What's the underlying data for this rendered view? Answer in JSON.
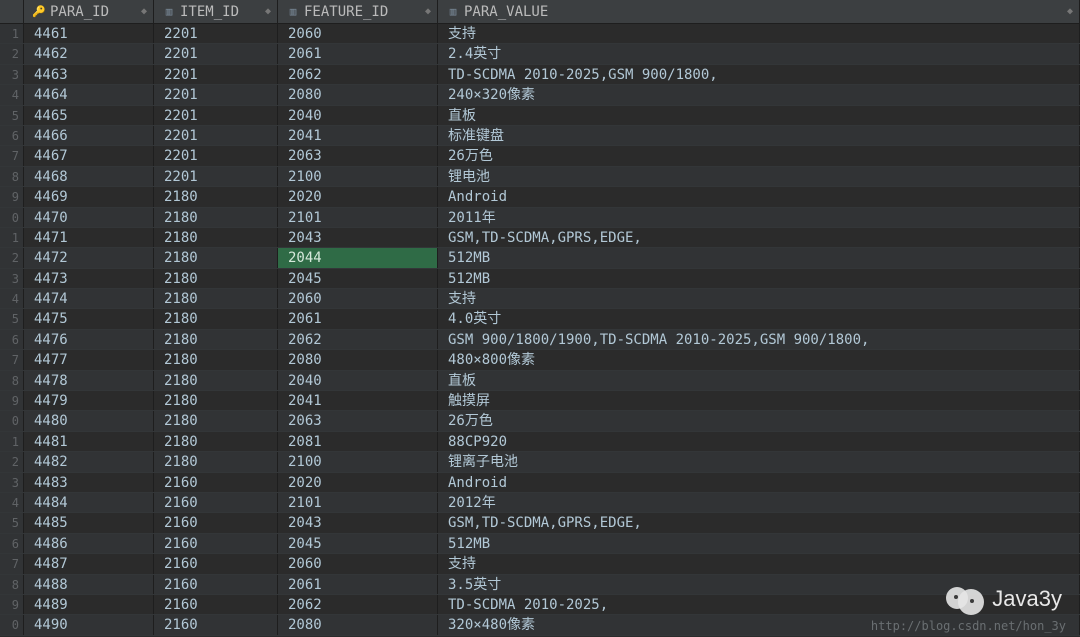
{
  "columns": [
    {
      "key": "para_id",
      "label": "PARA_ID",
      "icon": "key"
    },
    {
      "key": "item_id",
      "label": "ITEM_ID",
      "icon": "col"
    },
    {
      "key": "feature_id",
      "label": "FEATURE_ID",
      "icon": "col"
    },
    {
      "key": "para_value",
      "label": "PARA_VALUE",
      "icon": "col"
    }
  ],
  "highlight": {
    "row_index": 11,
    "col": "feature_id"
  },
  "rows": [
    {
      "n": "1",
      "para_id": "4461",
      "item_id": "2201",
      "feature_id": "2060",
      "para_value": "支持"
    },
    {
      "n": "2",
      "para_id": "4462",
      "item_id": "2201",
      "feature_id": "2061",
      "para_value": "2.4英寸"
    },
    {
      "n": "3",
      "para_id": "4463",
      "item_id": "2201",
      "feature_id": "2062",
      "para_value": "TD-SCDMA 2010-2025,GSM 900/1800,"
    },
    {
      "n": "4",
      "para_id": "4464",
      "item_id": "2201",
      "feature_id": "2080",
      "para_value": "240×320像素"
    },
    {
      "n": "5",
      "para_id": "4465",
      "item_id": "2201",
      "feature_id": "2040",
      "para_value": "直板"
    },
    {
      "n": "6",
      "para_id": "4466",
      "item_id": "2201",
      "feature_id": "2041",
      "para_value": "标准键盘"
    },
    {
      "n": "7",
      "para_id": "4467",
      "item_id": "2201",
      "feature_id": "2063",
      "para_value": "26万色"
    },
    {
      "n": "8",
      "para_id": "4468",
      "item_id": "2201",
      "feature_id": "2100",
      "para_value": "锂电池"
    },
    {
      "n": "9",
      "para_id": "4469",
      "item_id": "2180",
      "feature_id": "2020",
      "para_value": "Android"
    },
    {
      "n": "0",
      "para_id": "4470",
      "item_id": "2180",
      "feature_id": "2101",
      "para_value": "2011年"
    },
    {
      "n": "1",
      "para_id": "4471",
      "item_id": "2180",
      "feature_id": "2043",
      "para_value": "GSM,TD-SCDMA,GPRS,EDGE,"
    },
    {
      "n": "2",
      "para_id": "4472",
      "item_id": "2180",
      "feature_id": "2044",
      "para_value": "512MB"
    },
    {
      "n": "3",
      "para_id": "4473",
      "item_id": "2180",
      "feature_id": "2045",
      "para_value": "512MB"
    },
    {
      "n": "4",
      "para_id": "4474",
      "item_id": "2180",
      "feature_id": "2060",
      "para_value": "支持"
    },
    {
      "n": "5",
      "para_id": "4475",
      "item_id": "2180",
      "feature_id": "2061",
      "para_value": "4.0英寸"
    },
    {
      "n": "6",
      "para_id": "4476",
      "item_id": "2180",
      "feature_id": "2062",
      "para_value": "GSM 900/1800/1900,TD-SCDMA 2010-2025,GSM 900/1800,"
    },
    {
      "n": "7",
      "para_id": "4477",
      "item_id": "2180",
      "feature_id": "2080",
      "para_value": "480×800像素"
    },
    {
      "n": "8",
      "para_id": "4478",
      "item_id": "2180",
      "feature_id": "2040",
      "para_value": "直板"
    },
    {
      "n": "9",
      "para_id": "4479",
      "item_id": "2180",
      "feature_id": "2041",
      "para_value": "触摸屏"
    },
    {
      "n": "0",
      "para_id": "4480",
      "item_id": "2180",
      "feature_id": "2063",
      "para_value": "26万色"
    },
    {
      "n": "1",
      "para_id": "4481",
      "item_id": "2180",
      "feature_id": "2081",
      "para_value": "88CP920"
    },
    {
      "n": "2",
      "para_id": "4482",
      "item_id": "2180",
      "feature_id": "2100",
      "para_value": "锂离子电池"
    },
    {
      "n": "3",
      "para_id": "4483",
      "item_id": "2160",
      "feature_id": "2020",
      "para_value": "Android"
    },
    {
      "n": "4",
      "para_id": "4484",
      "item_id": "2160",
      "feature_id": "2101",
      "para_value": "2012年"
    },
    {
      "n": "5",
      "para_id": "4485",
      "item_id": "2160",
      "feature_id": "2043",
      "para_value": "GSM,TD-SCDMA,GPRS,EDGE,"
    },
    {
      "n": "6",
      "para_id": "4486",
      "item_id": "2160",
      "feature_id": "2045",
      "para_value": "512MB"
    },
    {
      "n": "7",
      "para_id": "4487",
      "item_id": "2160",
      "feature_id": "2060",
      "para_value": "支持"
    },
    {
      "n": "8",
      "para_id": "4488",
      "item_id": "2160",
      "feature_id": "2061",
      "para_value": "3.5英寸"
    },
    {
      "n": "9",
      "para_id": "4489",
      "item_id": "2160",
      "feature_id": "2062",
      "para_value": "TD-SCDMA 2010-2025,"
    },
    {
      "n": "0",
      "para_id": "4490",
      "item_id": "2160",
      "feature_id": "2080",
      "para_value": "320×480像素"
    }
  ],
  "watermark": {
    "label": "Java3y",
    "url": "http://blog.csdn.net/hon_3y"
  }
}
